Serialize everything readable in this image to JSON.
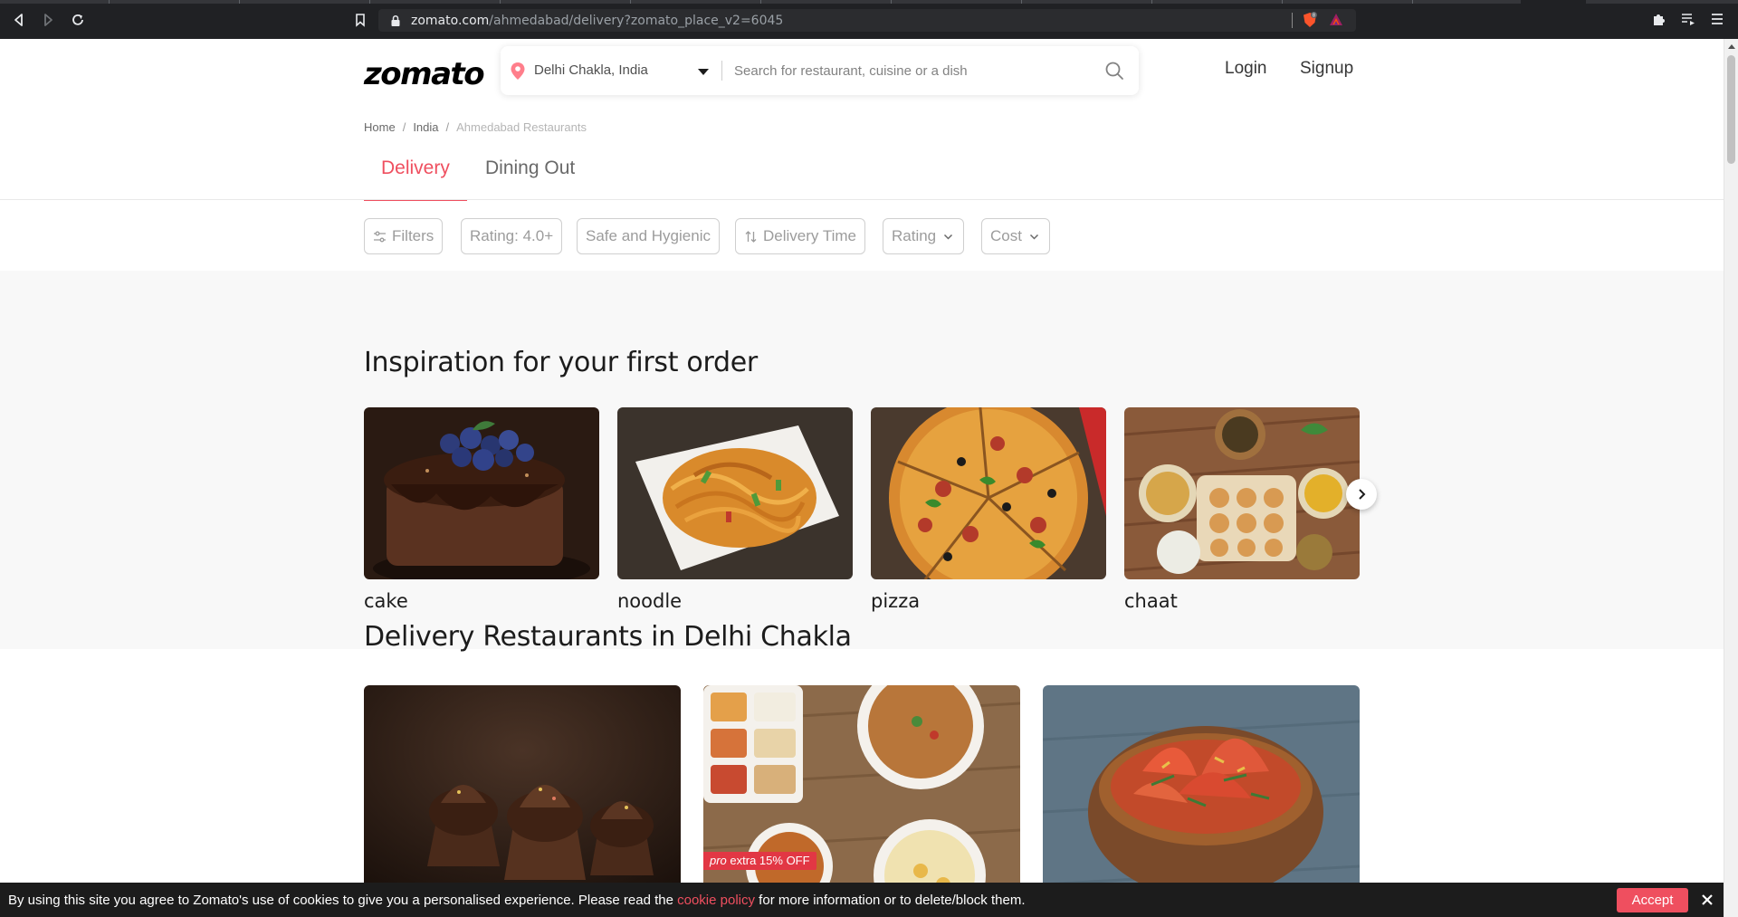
{
  "browser": {
    "url_host": "zomato.com",
    "url_path": "/ahmedabad/delivery?zomato_place_v2=6045",
    "shield_count": "8",
    "icons": [
      "back-icon",
      "forward-icon",
      "reload-icon",
      "bookmark-icon",
      "lock-icon",
      "brave-shield-icon",
      "rewards-icon",
      "extensions-icon",
      "playlist-icon",
      "menu-icon"
    ]
  },
  "header": {
    "logo": "zomato",
    "location": "Delhi Chakla, India",
    "search_placeholder": "Search for restaurant, cuisine or a dish",
    "login": "Login",
    "signup": "Signup"
  },
  "breadcrumb": {
    "items": [
      "Home",
      "India",
      "Ahmedabad Restaurants"
    ],
    "separator": "/"
  },
  "tabs": [
    {
      "label": "Delivery",
      "active": true
    },
    {
      "label": "Dining Out",
      "active": false
    }
  ],
  "filters": [
    "Filters",
    "Rating: 4.0+",
    "Safe and Hygienic",
    "Delivery Time",
    "Rating",
    "Cost"
  ],
  "inspiration": {
    "title": "Inspiration for your first order",
    "items": [
      "cake",
      "noodle",
      "pizza",
      "chaat"
    ]
  },
  "delivery": {
    "title": "Delivery Restaurants in Delhi Chakla",
    "badge_pro": "pro",
    "badge_text": "extra 15% OFF"
  },
  "cookie": {
    "text_before": "By using this site you agree to Zomato's use of cookies to give you a personalised experience. Please read the ",
    "link": "cookie policy",
    "text_after": " for more information or to delete/block them.",
    "accept": "Accept"
  },
  "colors": {
    "brand": "#ef4f5f",
    "text": "#1c1c1c",
    "badge": "#e23744"
  }
}
